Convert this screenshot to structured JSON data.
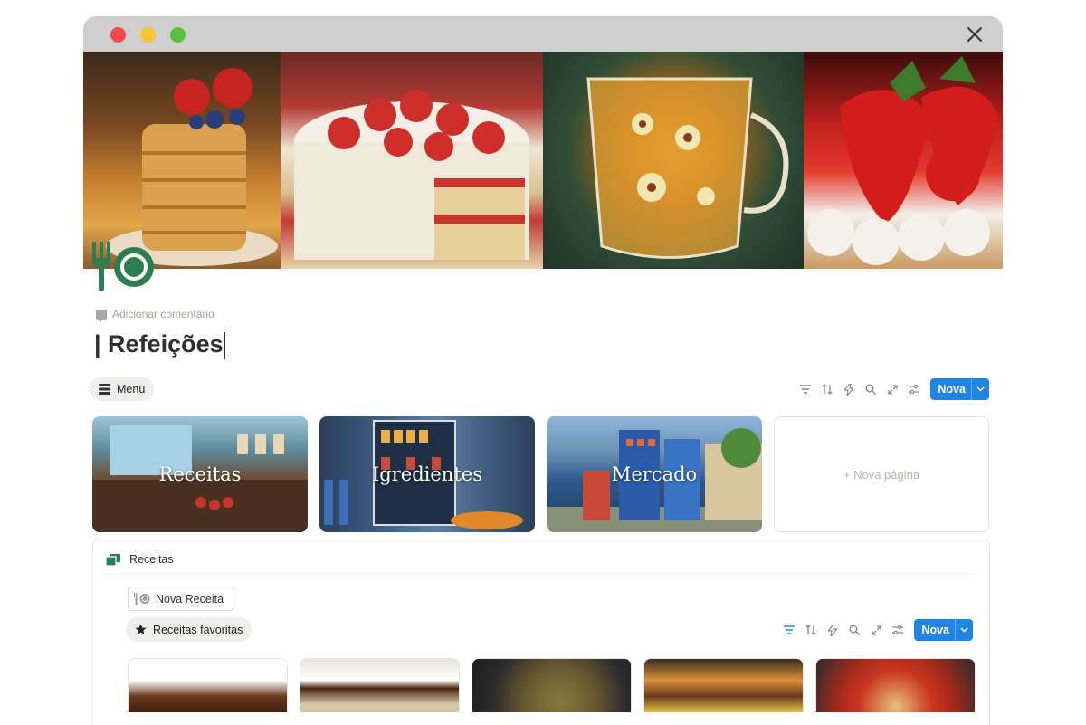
{
  "window": {
    "close_label": "×"
  },
  "comment": {
    "add_label": "Adicionar comentário"
  },
  "page": {
    "title": "| Refeições"
  },
  "menu_chip": {
    "label": "Menu"
  },
  "toolbar": {
    "new_label": "Nova"
  },
  "gallery": {
    "cards": [
      {
        "caption": "Receitas"
      },
      {
        "caption": "Igredientes"
      },
      {
        "caption": "Mercado"
      }
    ],
    "new_page_label": "+ Nova página"
  },
  "database": {
    "title": "Receitas",
    "new_recipe_label": "Nova Receita",
    "favorites_label": "Receitas favoritas",
    "new_label": "Nova"
  },
  "colors": {
    "accent": "#2383e2",
    "icon_green": "#2e7d4f"
  }
}
